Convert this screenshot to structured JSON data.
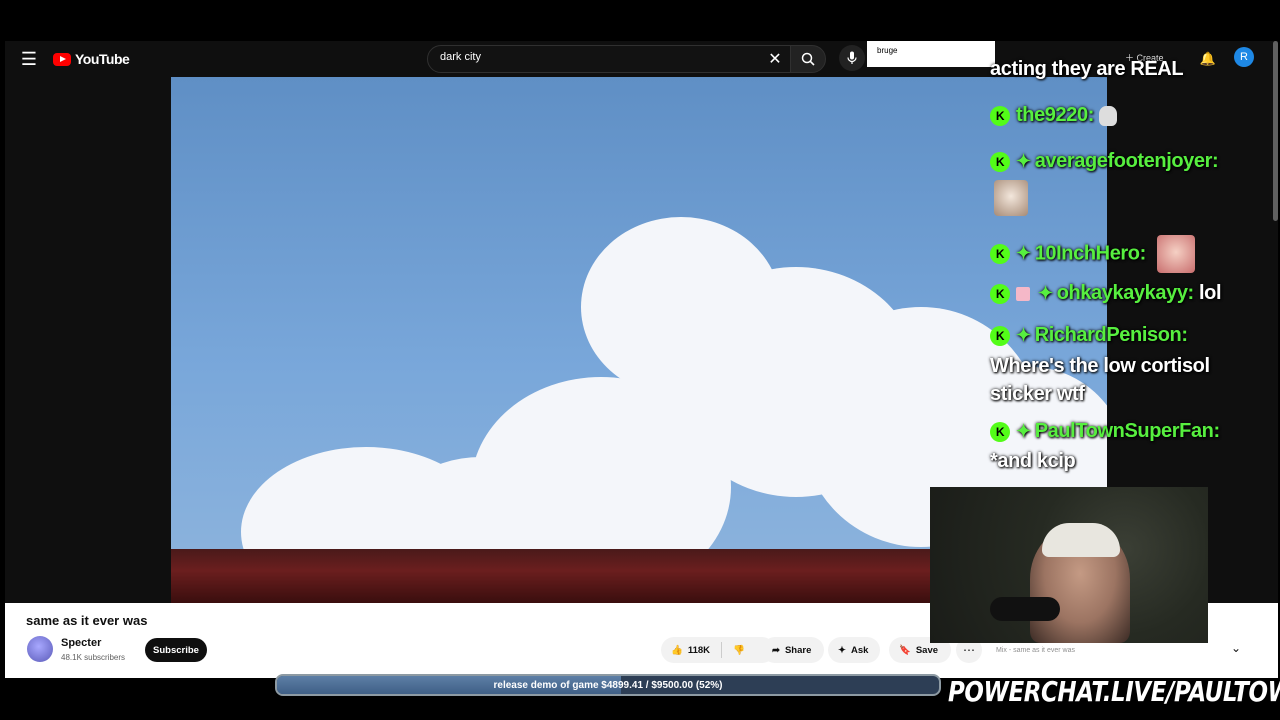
{
  "header": {
    "logo_text": "YouTube",
    "search_value": "dark city",
    "overlay_search_value": "bruge",
    "create_label": "Create",
    "avatar_initial": "R"
  },
  "video": {
    "title": "same as it ever was",
    "channel": "Specter",
    "subscribers": "48.1K subscribers",
    "subscribe_label": "Subscribe",
    "likes": "118K",
    "share_label": "Share",
    "ask_label": "Ask",
    "save_label": "Save",
    "mix_label": "Mix - same as it ever was"
  },
  "chat": {
    "top_message": "acting they are REAL",
    "messages": [
      {
        "user": "the9220:",
        "text": ""
      },
      {
        "user": "averagefootenjoyer:",
        "text": ""
      },
      {
        "user": "10InchHero:",
        "text": ""
      },
      {
        "user": "ohkaykaykayy:",
        "text": "lol"
      },
      {
        "user": "RichardPenison:",
        "text": "Where's the low cortisol sticker wtf"
      },
      {
        "user": "PaulTownSuperFan:",
        "text": "*and kcip"
      }
    ]
  },
  "donation": {
    "text": "release demo of game $4899.41 / $9500.00 (52%)",
    "progress": 0.52
  },
  "promo": "POWERCHAT.LIVE/PAULTOWN",
  "colors": {
    "chat_username": "#57ef3f",
    "kick_badge": "#53fc18",
    "subscribe_bg": "#0f0f0f"
  }
}
